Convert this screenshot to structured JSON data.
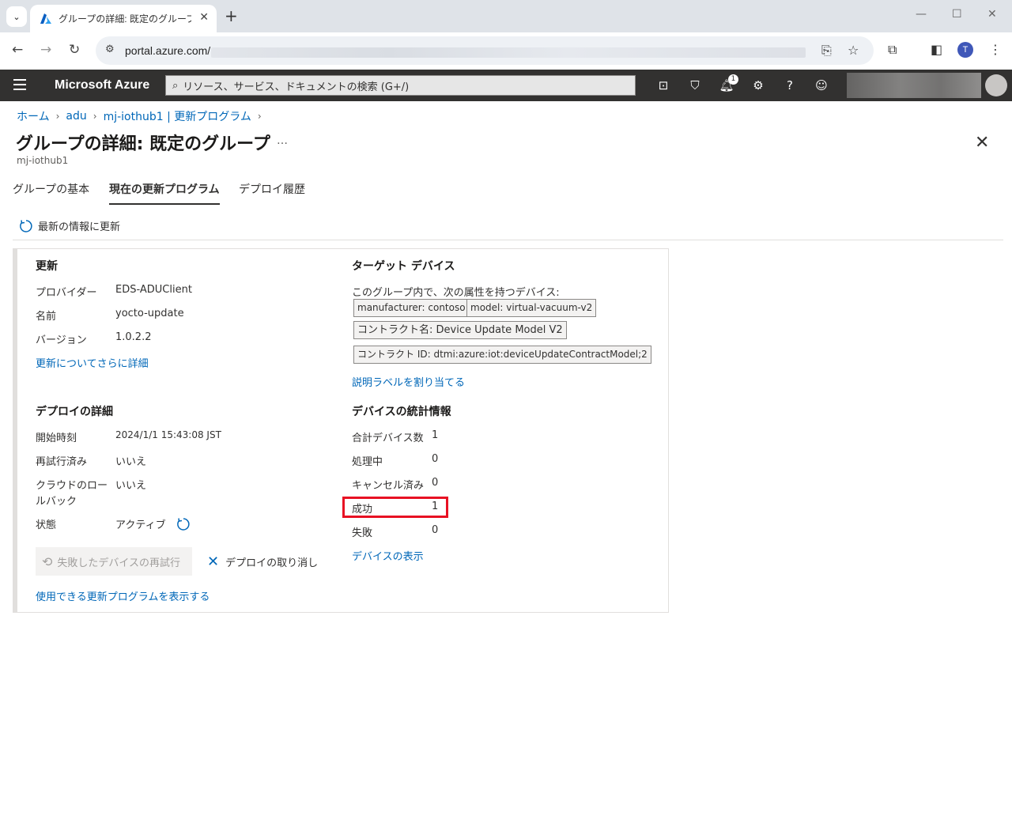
{
  "browser": {
    "tab_title": "グループの詳細: 既定のグループ - M",
    "url": "portal.azure.com/",
    "profile_initial": "T"
  },
  "azure": {
    "brand": "Microsoft Azure",
    "search_placeholder": "リソース、サービス、ドキュメントの検索 (G+/)",
    "notification_count": "1"
  },
  "breadcrumb": [
    "ホーム",
    "adu",
    "mj-iothub1 | 更新プログラム"
  ],
  "header": {
    "title": "グループの詳細: 既定のグループ",
    "more": "…",
    "subtitle": "mj-iothub1"
  },
  "tabs": [
    "グループの基本",
    "現在の更新プログラム",
    "デプロイ履歴"
  ],
  "active_tab": "現在の更新プログラム",
  "command": {
    "refresh": "最新の情報に更新"
  },
  "update": {
    "title": "更新",
    "provider_label": "プロバイダー",
    "provider": "EDS-ADUClient",
    "name_label": "名前",
    "name": "yocto-update",
    "version_label": "バージョン",
    "version": "1.0.2.2",
    "more_link": "更新についてさらに詳細"
  },
  "target": {
    "title": "ターゲット デバイス",
    "desc": "このグループ内で、次の属性を持つデバイス:",
    "chips": [
      "manufacturer: contoso",
      "model: virtual-vacuum-v2",
      "コントラクト名: Device Update Model V2",
      "コントラクト ID: dtmi:azure:iot:deviceUpdateContractModel;2"
    ],
    "assign_link": "説明ラベルを割り当てる"
  },
  "deploy": {
    "title": "デプロイの詳細",
    "start_label": "開始時刻",
    "start": "2024/1/1 15:43:08 JST",
    "retried_label": "再試行済み",
    "retried": "いいえ",
    "rollback_label_1": "クラウドのロー",
    "rollback_label_2": "ルバック",
    "rollback": "いいえ",
    "state_label": "状態",
    "state": "アクティブ",
    "retry_button": "失敗したデバイスの再試行",
    "cancel_button": "デプロイの取り消し",
    "available_link": "使用できる更新プログラムを表示する"
  },
  "stats": {
    "title": "デバイスの統計情報",
    "total_label": "合計デバイス数",
    "total": "1",
    "inprogress_label": "処理中",
    "inprogress": "0",
    "canceled_label": "キャンセル済み",
    "canceled": "0",
    "succeeded_label": "成功",
    "succeeded": "1",
    "failed_label": "失敗",
    "failed": "0",
    "view_link": "デバイスの表示"
  },
  "colors": {
    "azure_bar": "#323130",
    "link": "#0067b8",
    "highlight": "#e81123"
  }
}
